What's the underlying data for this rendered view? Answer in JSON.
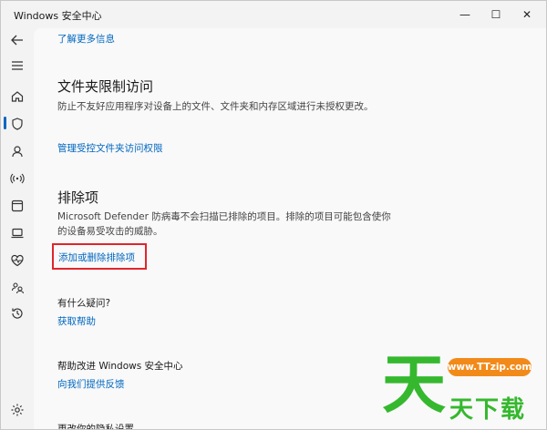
{
  "window": {
    "title": "Windows 安全中心",
    "minimize": "—",
    "maximize": "☐",
    "close": "✕"
  },
  "nav": {
    "items": [
      {
        "name": "back-icon",
        "active": false
      },
      {
        "name": "menu-icon",
        "active": false
      },
      {
        "name": "home-icon",
        "active": false
      },
      {
        "name": "shield-icon",
        "active": true
      },
      {
        "name": "account-icon",
        "active": false
      },
      {
        "name": "network-icon",
        "active": false
      },
      {
        "name": "app-browser-icon",
        "active": false
      },
      {
        "name": "device-security-icon",
        "active": false
      },
      {
        "name": "health-icon",
        "active": false
      },
      {
        "name": "family-icon",
        "active": false
      },
      {
        "name": "history-icon",
        "active": false
      },
      {
        "name": "settings-icon",
        "active": false
      }
    ]
  },
  "content": {
    "learn_more_link": "了解更多信息",
    "folder_access": {
      "heading": "文件夹限制访问",
      "description": "防止不友好应用程序对设备上的文件、文件夹和内存区域进行未授权更改。",
      "link": "管理受控文件夹访问权限"
    },
    "exclusions": {
      "heading": "排除项",
      "description": "Microsoft Defender 防病毒不会扫描已排除的项目。排除的项目可能包含使你的设备易受攻击的威胁。",
      "link": "添加或删除排除项"
    },
    "questions": {
      "heading": "有什么疑问?",
      "link": "获取帮助"
    },
    "improve": {
      "heading": "帮助改进 Windows 安全中心",
      "link": "向我们提供反馈"
    },
    "privacy": {
      "heading": "更改你的隐私设置"
    }
  },
  "watermark": {
    "url": "www.TTzip.com",
    "text": "天下载",
    "big_glyph": "天"
  },
  "colors": {
    "accent": "#0067c0",
    "highlight_border": "#e0262b",
    "watermark_green": "#35b82e",
    "watermark_orange": "#f28a1a"
  }
}
